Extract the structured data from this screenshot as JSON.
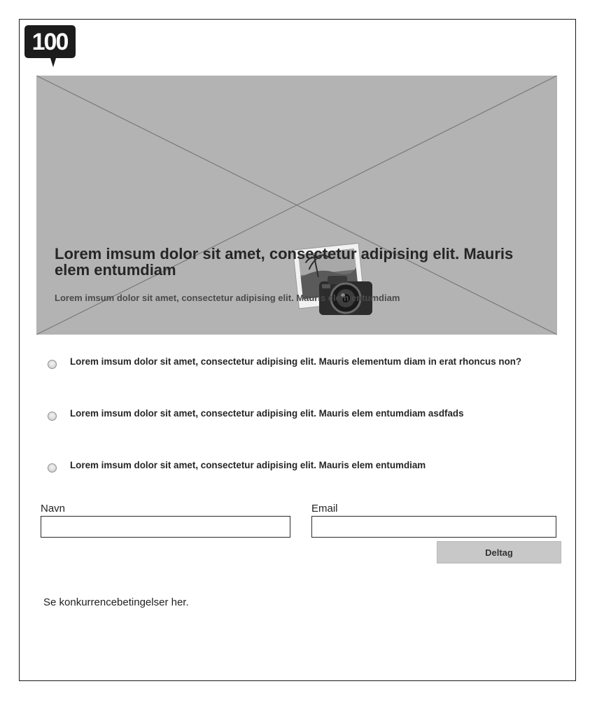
{
  "logo": {
    "text": "100",
    "icon": "speech-bubble-logo"
  },
  "hero": {
    "image_placeholder_icon": "photo-camera-icon",
    "title": "Lorem imsum dolor sit amet, consectetur adipising elit. Mauris elem entumdiam",
    "subtitle": "Lorem imsum dolor sit amet, consectetur adipising elit. Mauris elem entumdiam",
    "background": "#b3b3b3"
  },
  "options": [
    {
      "label": "Lorem imsum dolor sit amet, consectetur adipising elit. Mauris elementum diam in erat rhoncus non?",
      "checked": false
    },
    {
      "label": "Lorem imsum dolor sit amet, consectetur adipising elit. Mauris elem entumdiam asdfads",
      "checked": false
    },
    {
      "label": "Lorem imsum dolor sit amet, consectetur adipising elit. Mauris elem entumdiam",
      "checked": false
    }
  ],
  "form": {
    "name_label": "Navn",
    "name_value": "",
    "email_label": "Email",
    "email_value": "",
    "submit_label": "Deltag"
  },
  "terms_link": "Se konkurrencebetingelser her."
}
